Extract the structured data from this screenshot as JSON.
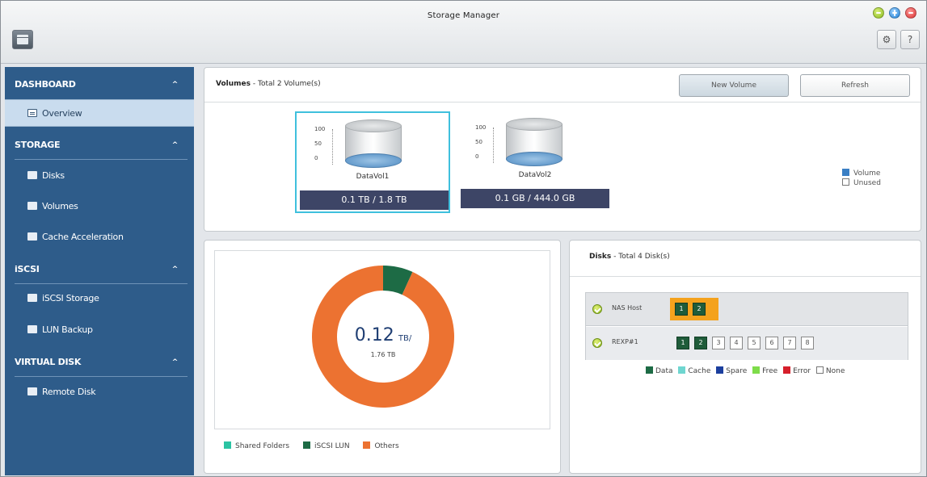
{
  "window": {
    "title": "Storage Manager"
  },
  "sidebar": {
    "sections": [
      {
        "label": "DASHBOARD",
        "items": [
          "Overview"
        ]
      },
      {
        "label": "STORAGE",
        "items": [
          "Disks",
          "Volumes",
          "Cache Acceleration"
        ]
      },
      {
        "label": "iSCSI",
        "items": [
          "iSCSI Storage",
          "LUN Backup"
        ]
      },
      {
        "label": "VIRTUAL DISK",
        "items": [
          "Remote Disk"
        ]
      }
    ],
    "active_item": "Overview"
  },
  "volumes": {
    "title": "Volumes",
    "subtitle": " - Total 2 Volume(s)",
    "new_button": "New Volume",
    "refresh_button": "Refresh",
    "axis_ticks": [
      "100",
      "50",
      "0"
    ],
    "items": [
      {
        "name": "DataVol1",
        "usage": "0.1 TB / 1.8 TB",
        "selected": true
      },
      {
        "name": "DataVol2",
        "usage": "0.1 GB / 444.0 GB",
        "selected": false
      }
    ],
    "legend": [
      {
        "label": "Volume",
        "color": "#3a7fc4"
      },
      {
        "label": "Unused",
        "color": "#ffffff"
      }
    ]
  },
  "usage": {
    "total_value": "0.12",
    "total_unit": "TB/",
    "capacity": "1.76 TB",
    "legend": [
      {
        "label": "Shared Folders",
        "color": "#2bc3a3"
      },
      {
        "label": "iSCSI LUN",
        "color": "#1d6b45"
      },
      {
        "label": "Others",
        "color": "#ec7231"
      }
    ],
    "slices": [
      {
        "name": "iSCSI LUN",
        "fraction": 0.068,
        "color": "#1d6b45"
      },
      {
        "name": "Others",
        "fraction": 0.932,
        "color": "#ec7231"
      }
    ]
  },
  "disks": {
    "title": "Disks",
    "subtitle": " - Total 4 Disk(s)",
    "hosts": [
      {
        "name": "NAS Host",
        "slots": [
          {
            "n": "1",
            "state": "data"
          },
          {
            "n": "2",
            "state": "data"
          }
        ]
      },
      {
        "name": "REXP#1",
        "slots": [
          {
            "n": "1",
            "state": "data"
          },
          {
            "n": "2",
            "state": "data"
          },
          {
            "n": "3",
            "state": "none"
          },
          {
            "n": "4",
            "state": "none"
          },
          {
            "n": "5",
            "state": "none"
          },
          {
            "n": "6",
            "state": "none"
          },
          {
            "n": "7",
            "state": "none"
          },
          {
            "n": "8",
            "state": "none"
          }
        ]
      }
    ],
    "legend": [
      {
        "label": "Data",
        "color": "#1d6b45"
      },
      {
        "label": "Cache",
        "color": "#6fd6d0"
      },
      {
        "label": "Spare",
        "color": "#1c3f9e"
      },
      {
        "label": "Free",
        "color": "#7edc4a"
      },
      {
        "label": "Error",
        "color": "#d61f2b"
      },
      {
        "label": "None",
        "color": "#ffffff"
      }
    ]
  }
}
